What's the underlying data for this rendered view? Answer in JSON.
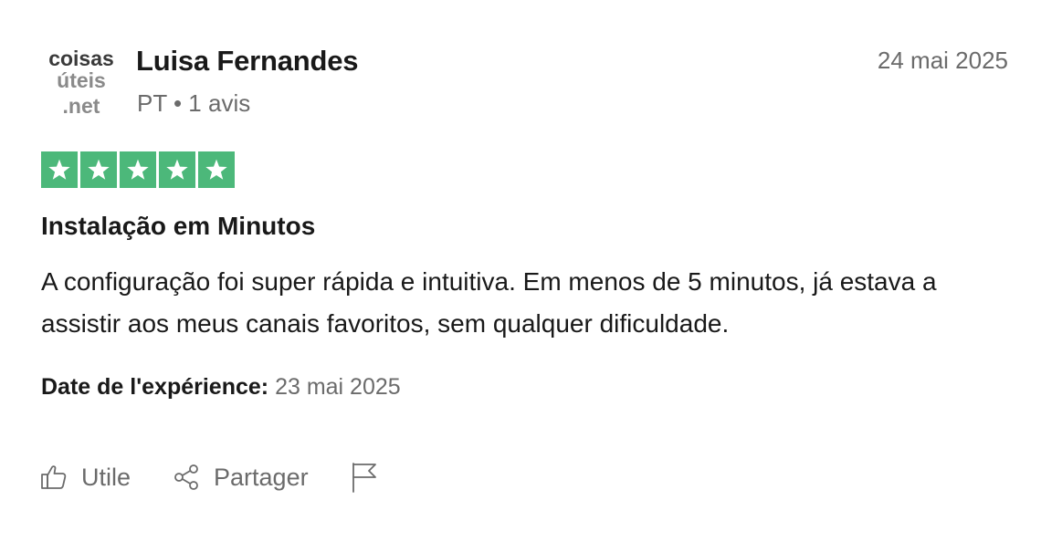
{
  "review": {
    "avatar": {
      "line1": "coisas",
      "line2": "úteis",
      "line3": ".net",
      "icon": "brand-logo-avatar"
    },
    "author_name": "Luisa Fernandes",
    "author_meta": "PT • 1 avis",
    "date": "24 mai 2025",
    "rating": 5,
    "star_color": "#4cb87a",
    "title": "Instalação em Minutos",
    "body": "A configuração foi super rápida e intuitiva. Em menos de 5 minutos, já estava a assistir aos meus canais favoritos, sem qualquer dificuldade.",
    "experience_label": "Date de l'expérience:",
    "experience_date": "23 mai 2025"
  },
  "actions": {
    "useful_label": "Utile",
    "useful_icon": "thumbs-up-icon",
    "share_label": "Partager",
    "share_icon": "share-icon",
    "report_icon": "flag-icon"
  }
}
